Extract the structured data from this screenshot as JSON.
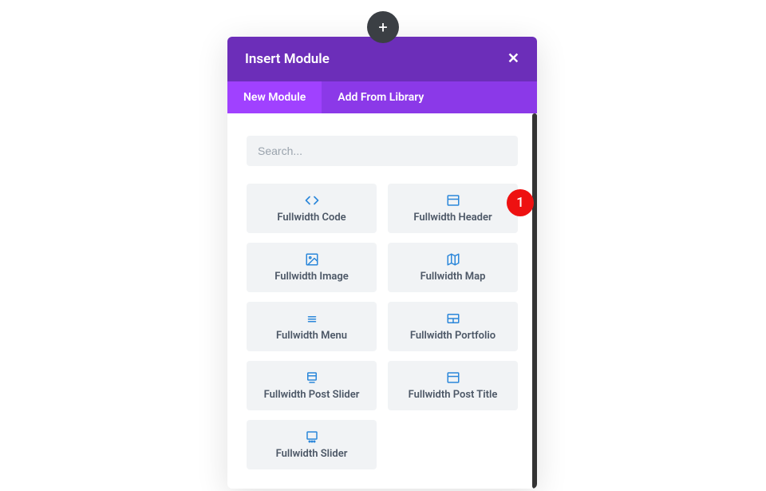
{
  "add_button": {
    "label": "+"
  },
  "modal": {
    "title": "Insert Module",
    "close": "✕",
    "tabs": [
      {
        "label": "New Module",
        "active": true
      },
      {
        "label": "Add From Library",
        "active": false
      }
    ],
    "search": {
      "placeholder": "Search..."
    },
    "modules": [
      {
        "name": "Fullwidth Code",
        "icon": "code-icon",
        "badge": null
      },
      {
        "name": "Fullwidth Header",
        "icon": "header-icon",
        "badge": "1"
      },
      {
        "name": "Fullwidth Image",
        "icon": "image-icon",
        "badge": null
      },
      {
        "name": "Fullwidth Map",
        "icon": "map-icon",
        "badge": null
      },
      {
        "name": "Fullwidth Menu",
        "icon": "menu-icon",
        "badge": null
      },
      {
        "name": "Fullwidth Portfolio",
        "icon": "portfolio-icon",
        "badge": null
      },
      {
        "name": "Fullwidth Post Slider",
        "icon": "post-slider-icon",
        "badge": null
      },
      {
        "name": "Fullwidth Post Title",
        "icon": "post-title-icon",
        "badge": null
      },
      {
        "name": "Fullwidth Slider",
        "icon": "slider-icon",
        "badge": null
      }
    ]
  },
  "icons": {
    "code-icon": "<svg viewBox='0 0 24 24' fill='none' stroke='currentColor' stroke-width='2.2' stroke-linecap='round' stroke-linejoin='round'><polyline points='16 18 22 12 16 6'/><polyline points='8 6 2 12 8 18'/></svg>",
    "header-icon": "<svg viewBox='0 0 24 24' fill='none' stroke='currentColor' stroke-width='2' stroke-linecap='round'><rect x='3' y='4' width='18' height='16' rx='1'/><line x1='3' y1='10' x2='21' y2='10'/></svg>",
    "image-icon": "<svg viewBox='0 0 24 24' fill='none' stroke='currentColor' stroke-width='2' stroke-linecap='round' stroke-linejoin='round'><rect x='3' y='3' width='18' height='18' rx='1'/><circle cx='9' cy='9' r='1.5'/><polyline points='21 15 16 10 5 21'/></svg>",
    "map-icon": "<svg viewBox='0 0 24 24' fill='none' stroke='currentColor' stroke-width='2' stroke-linecap='round' stroke-linejoin='round'><polygon points='3 6 9 3 15 6 21 3 21 18 15 21 9 18 3 21'/><line x1='9' y1='3' x2='9' y2='18'/><line x1='15' y1='6' x2='15' y2='21'/></svg>",
    "menu-icon": "<svg viewBox='0 0 24 24' fill='none' stroke='currentColor' stroke-width='2' stroke-linecap='round'><line x1='6' y1='9' x2='18' y2='9'/><line x1='6' y1='13' x2='18' y2='13'/><line x1='6' y1='17' x2='18' y2='17'/></svg>",
    "portfolio-icon": "<svg viewBox='0 0 24 24' fill='none' stroke='currentColor' stroke-width='2' stroke-linecap='round'><rect x='3' y='5' width='18' height='14' rx='1'/><line x1='3' y1='12' x2='21' y2='12'/><line x1='12' y1='12' x2='12' y2='19'/></svg>",
    "post-slider-icon": "<svg viewBox='0 0 24 24' fill='none' stroke='currentColor' stroke-width='2' stroke-linecap='round'><rect x='5' y='4' width='14' height='12' rx='1'/><line x1='5' y1='9' x2='19' y2='9'/><line x1='8' y1='20' x2='16' y2='20'/></svg>",
    "post-title-icon": "<svg viewBox='0 0 24 24' fill='none' stroke='currentColor' stroke-width='2' stroke-linecap='round'><rect x='3' y='4' width='18' height='16' rx='1'/><line x1='3' y1='10' x2='21' y2='10'/></svg>",
    "slider-icon": "<svg viewBox='0 0 24 24' fill='none' stroke='currentColor' stroke-width='2' stroke-linecap='round'><rect x='4' y='4' width='16' height='12' rx='1'/><circle cx='8' cy='20' r='1' fill='currentColor'/><circle cx='12' cy='20' r='1' fill='currentColor'/><circle cx='16' cy='20' r='1' fill='currentColor'/></svg>"
  }
}
